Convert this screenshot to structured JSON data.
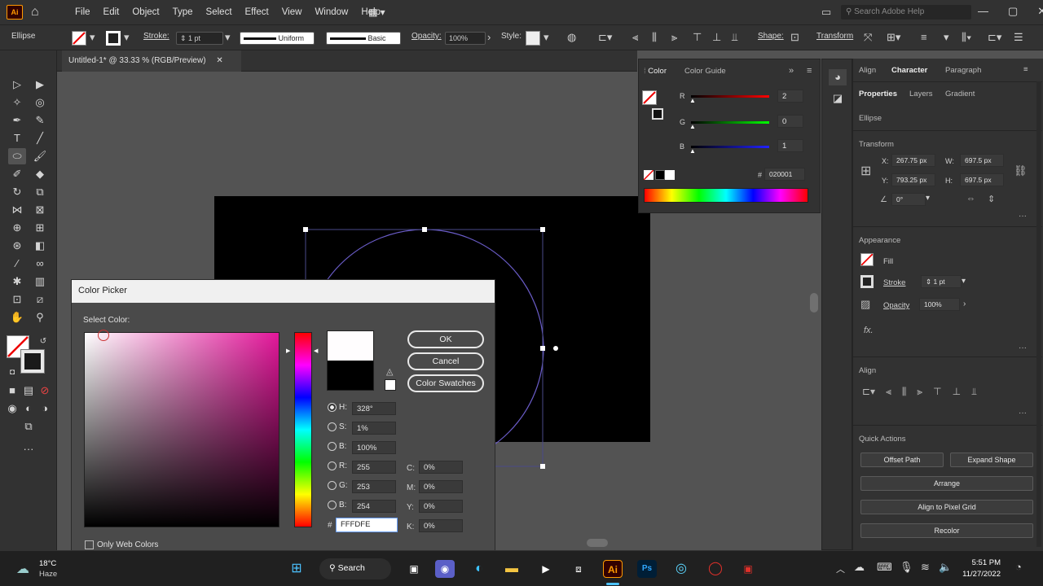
{
  "menu": {
    "logo": "Ai",
    "items": [
      "File",
      "Edit",
      "Object",
      "Type",
      "Select",
      "Effect",
      "View",
      "Window",
      "Help"
    ],
    "search_placeholder": "Search Adobe Help"
  },
  "control_bar": {
    "object": "Ellipse",
    "stroke_label": "Stroke:",
    "stroke_value": "1 pt",
    "profile": "Uniform",
    "brush": "Basic",
    "opacity_label": "Opacity:",
    "opacity_value": "100%",
    "style_label": "Style:",
    "shape_label": "Shape:",
    "transform_label": "Transform"
  },
  "document": {
    "tab_title": "Untitled-1* @ 33.33 % (RGB/Preview)"
  },
  "color_panel": {
    "tab_color": "Color",
    "tab_guide": "Color Guide",
    "r_label": "R",
    "r_value": "2",
    "g_label": "G",
    "g_value": "0",
    "b_label": "B",
    "b_value": "1",
    "hex_value": "020001"
  },
  "right_panel": {
    "tabs": [
      "Align",
      "Character",
      "Paragraph"
    ],
    "subtabs": [
      "Properties",
      "Layers",
      "Gradient"
    ],
    "object": "Ellipse",
    "transform_title": "Transform",
    "x_label": "X:",
    "x_value": "267.75 px",
    "y_label": "Y:",
    "y_value": "793.25 px",
    "w_label": "W:",
    "w_value": "697.5 px",
    "h_label": "H:",
    "h_value": "697.5 px",
    "angle_value": "0°",
    "appearance_title": "Appearance",
    "fill_label": "Fill",
    "stroke_label": "Stroke",
    "stroke_value": "1 pt",
    "opacity_label": "Opacity",
    "opacity_value": "100%",
    "fx_label": "fx.",
    "align_title": "Align",
    "quick_actions_title": "Quick Actions",
    "offset_path": "Offset Path",
    "expand_shape": "Expand Shape",
    "arrange": "Arrange",
    "align_pixel": "Align to Pixel Grid",
    "recolor": "Recolor"
  },
  "color_picker": {
    "title": "Color Picker",
    "select_color": "Select Color:",
    "ok": "OK",
    "cancel": "Cancel",
    "swatches": "Color Swatches",
    "h_label": "H:",
    "h_value": "328°",
    "s_label": "S:",
    "s_value": "1%",
    "b_label": "B:",
    "b_value": "100%",
    "r_label": "R:",
    "r_value": "255",
    "g_label": "G:",
    "g_value": "253",
    "bl_label": "B:",
    "bl_value": "254",
    "c_label": "C:",
    "c_value": "0%",
    "m_label": "M:",
    "m_value": "0%",
    "y_label": "Y:",
    "y_value": "0%",
    "k_label": "K:",
    "k_value": "0%",
    "hash": "#",
    "hex_value": "FFFDFE",
    "web_colors": "Only Web Colors"
  },
  "taskbar": {
    "weather_temp": "18°C",
    "weather_text": "Haze",
    "search": "Search",
    "time": "5:51 PM",
    "date": "11/27/2022"
  }
}
